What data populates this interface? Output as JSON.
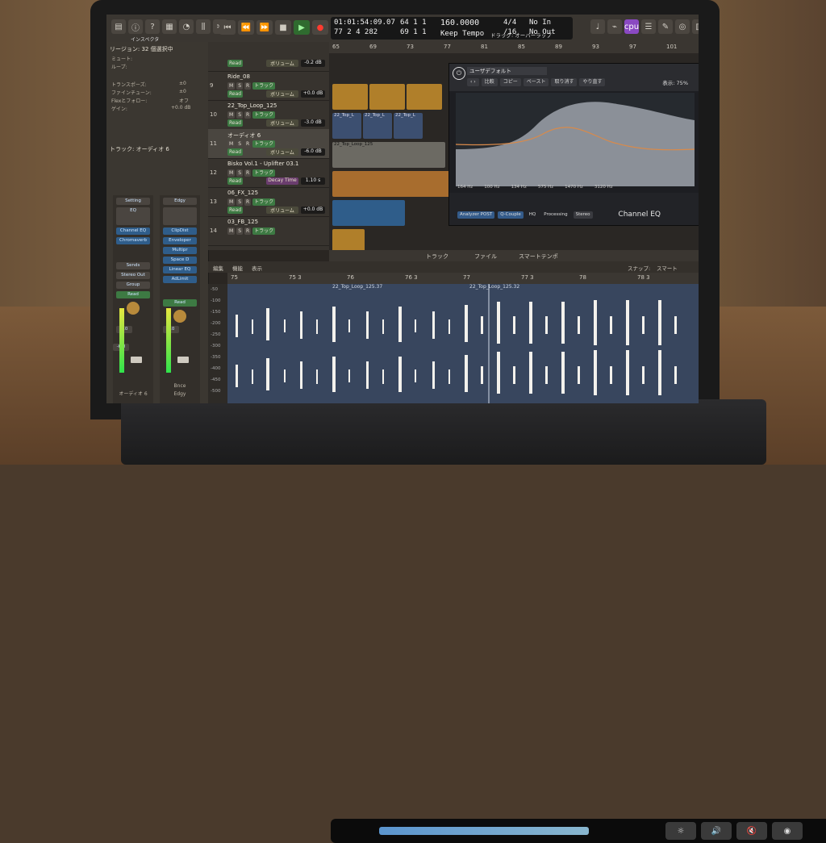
{
  "control_bar": {
    "tooltip": "インスペクタ",
    "time": "01:01:54:09.07",
    "bars": "77 2 4 282",
    "pos_top": "64 1 1",
    "pos_bottom": "69 1 1",
    "tempo": "160.0000",
    "tempo_mode": "Keep Tempo",
    "signature": "4/4",
    "division": "/16",
    "midi_in": "No In",
    "midi_out": "No Out",
    "cpu_label": "cpu"
  },
  "inspector": {
    "region_header": "リージョン: 32 個選択中",
    "rows": [
      "ミュート:",
      "ループ:",
      "トランスポーズ:",
      "ファインチューン:",
      "Flexとフォロー:",
      "ゲイン:"
    ],
    "row_values": [
      "",
      "",
      "±0",
      "±0",
      "オフ",
      "+0.0 dB"
    ],
    "track_header": "トラック: オーディオ 6",
    "strip1": {
      "setting": "Setting",
      "eq": "EQ",
      "plugins": [
        "Channel EQ",
        "Chromaverb"
      ],
      "sends": "Sends",
      "output": "Stereo Out",
      "group": "Group",
      "mode": "Read",
      "value_a": "0.0",
      "value_b": "-6.0",
      "name": "オーディオ 6"
    },
    "strip2": {
      "setting": "Edgy",
      "plugins": [
        "ClipDist",
        "Enveloper",
        "Multipr",
        "Space D",
        "Linear EQ",
        "AdLimit"
      ],
      "mode": "Read",
      "value_a": "0.0",
      "name": "Edgy",
      "label": "Bnce"
    }
  },
  "tracks": [
    {
      "num": "",
      "name": "",
      "mode": "Read",
      "param": "ボリューム",
      "value": "-0.2 dB"
    },
    {
      "num": "9",
      "name": "Ride_08",
      "mode": "Read",
      "param": "ボリューム",
      "value": "+0.0 dB"
    },
    {
      "num": "10",
      "name": "22_Top_Loop_125",
      "mode": "Read",
      "param": "ボリューム",
      "value": "-3.0 dB"
    },
    {
      "num": "11",
      "name": "オーディオ 6",
      "mode": "Read",
      "param": "ボリューム",
      "value": "-6.0 dB"
    },
    {
      "num": "12",
      "name": "Bisko Vol.1 - Uplifter 03.1",
      "mode": "Read",
      "param": "Decay Time",
      "value": "1.10 s"
    },
    {
      "num": "13",
      "name": "06_FX_125",
      "mode": "Read",
      "param": "ボリューム",
      "value": "+0.0 dB"
    },
    {
      "num": "14",
      "name": "03_FB_125",
      "mode": "",
      "param": "",
      "value": ""
    }
  ],
  "track_buttons": {
    "m": "M",
    "s": "S",
    "r": "R",
    "track": "トラック"
  },
  "arrange": {
    "ruler": [
      "65",
      "69",
      "73",
      "77",
      "81",
      "85",
      "89",
      "93",
      "97",
      "101"
    ],
    "drag_label": "ドラッグ:",
    "drag_value": "オーバーラップ",
    "snap_label": "スナップ:",
    "snap_value": "スマート",
    "region_label": "22_Top_Loop_125",
    "region_short": "22_Top_L"
  },
  "eq": {
    "preset": "ユーザデフォルト",
    "buttons": [
      "比較",
      "コピー",
      "ペースト",
      "取り消す",
      "やり直す"
    ],
    "zoom_label": "表示:",
    "zoom": "75%",
    "params": [
      "164 Hz",
      "100 Hz",
      "134 Hz",
      "575 Hz",
      "1470 Hz",
      "3120 Hz"
    ],
    "analyzer": "Analyzer POST",
    "qcouple": "Q-Couple",
    "hq": "HQ",
    "processing": "Processing",
    "processing_value": "Stereo",
    "name": "Channel EQ"
  },
  "editor": {
    "tabs": [
      "トラック",
      "ファイル",
      "スマートテンポ"
    ],
    "tools": [
      "編集",
      "機能",
      "表示"
    ],
    "snap_label": "スナップ:",
    "snap_value": "スマート",
    "ruler": [
      "75",
      "75 3",
      "76",
      "76 3",
      "77",
      "77 3",
      "78",
      "78 3"
    ],
    "region_a": "22_Top_Loop_125.37",
    "region_b": "22_Top_Loop_125.32",
    "db": [
      "-50",
      "-100",
      "-150",
      "-200",
      "-250",
      "-300",
      "-350",
      "-400",
      "-450",
      "-500"
    ]
  }
}
